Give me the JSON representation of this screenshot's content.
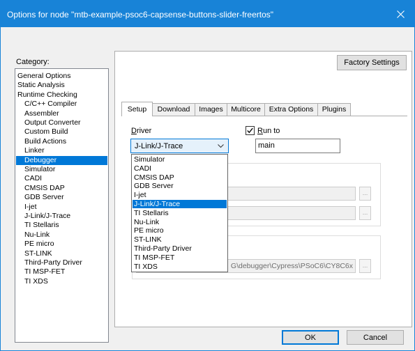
{
  "window": {
    "title": "Options for node \"mtb-example-psoc6-capsense-buttons-slider-freertos\""
  },
  "category": {
    "label": "Category:",
    "items": [
      {
        "label": "General Options",
        "child": false,
        "selected": false
      },
      {
        "label": "Static Analysis",
        "child": false,
        "selected": false
      },
      {
        "label": "Runtime Checking",
        "child": false,
        "selected": false
      },
      {
        "label": "C/C++ Compiler",
        "child": true,
        "selected": false
      },
      {
        "label": "Assembler",
        "child": true,
        "selected": false
      },
      {
        "label": "Output Converter",
        "child": true,
        "selected": false
      },
      {
        "label": "Custom Build",
        "child": true,
        "selected": false
      },
      {
        "label": "Build Actions",
        "child": true,
        "selected": false
      },
      {
        "label": "Linker",
        "child": true,
        "selected": false
      },
      {
        "label": "Debugger",
        "child": true,
        "selected": true
      },
      {
        "label": "Simulator",
        "child": true,
        "selected": false
      },
      {
        "label": "CADI",
        "child": true,
        "selected": false
      },
      {
        "label": "CMSIS DAP",
        "child": true,
        "selected": false
      },
      {
        "label": "GDB Server",
        "child": true,
        "selected": false
      },
      {
        "label": "I-jet",
        "child": true,
        "selected": false
      },
      {
        "label": "J-Link/J-Trace",
        "child": true,
        "selected": false
      },
      {
        "label": "TI Stellaris",
        "child": true,
        "selected": false
      },
      {
        "label": "Nu-Link",
        "child": true,
        "selected": false
      },
      {
        "label": "PE micro",
        "child": true,
        "selected": false
      },
      {
        "label": "ST-LINK",
        "child": true,
        "selected": false
      },
      {
        "label": "Third-Party Driver",
        "child": true,
        "selected": false
      },
      {
        "label": "TI MSP-FET",
        "child": true,
        "selected": false
      },
      {
        "label": "TI XDS",
        "child": true,
        "selected": false
      }
    ]
  },
  "toolbar": {
    "factory_settings": "Factory Settings"
  },
  "tabs": [
    {
      "label": "Setup",
      "active": true
    },
    {
      "label": "Download",
      "active": false
    },
    {
      "label": "Images",
      "active": false
    },
    {
      "label": "Multicore",
      "active": false
    },
    {
      "label": "Extra Options",
      "active": false
    },
    {
      "label": "Plugins",
      "active": false
    }
  ],
  "setup": {
    "driver_label_first": "D",
    "driver_label_rest": "river",
    "driver_value": "J-Link/J-Trace",
    "run_to_checked": true,
    "run_to_label_first": "R",
    "run_to_label_rest": "un to",
    "run_to_value": "main",
    "device_path_visible": "G\\debugger\\Cypress\\PSoC6\\CY8C6x",
    "browse_label": "..."
  },
  "driver_options": [
    {
      "label": "Simulator",
      "selected": false
    },
    {
      "label": "CADI",
      "selected": false
    },
    {
      "label": "CMSIS DAP",
      "selected": false
    },
    {
      "label": "GDB Server",
      "selected": false
    },
    {
      "label": "I-jet",
      "selected": false
    },
    {
      "label": "J-Link/J-Trace",
      "selected": true
    },
    {
      "label": "TI Stellaris",
      "selected": false
    },
    {
      "label": "Nu-Link",
      "selected": false
    },
    {
      "label": "PE micro",
      "selected": false
    },
    {
      "label": "ST-LINK",
      "selected": false
    },
    {
      "label": "Third-Party Driver",
      "selected": false
    },
    {
      "label": "TI MSP-FET",
      "selected": false
    },
    {
      "label": "TI XDS",
      "selected": false
    }
  ],
  "dialog": {
    "ok": "OK",
    "cancel": "Cancel"
  },
  "colors": {
    "titlebar": "#1883d7",
    "selection": "#0078d7"
  }
}
